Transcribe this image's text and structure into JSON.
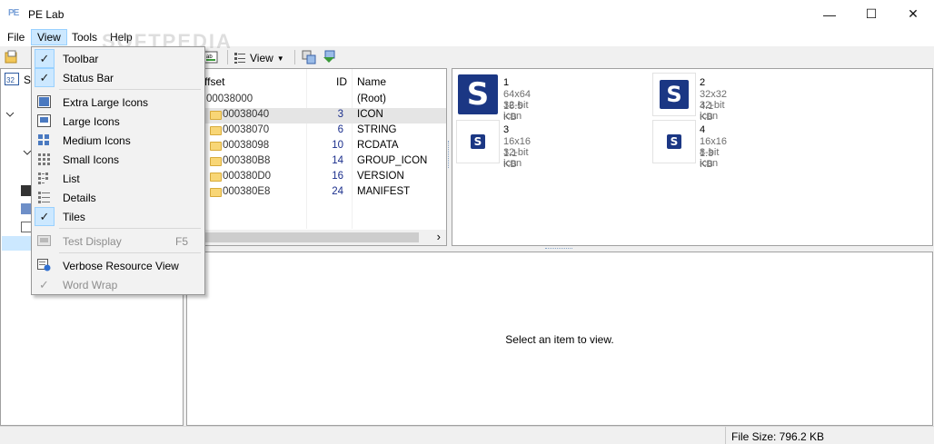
{
  "window": {
    "title": "PE Lab",
    "app_icon_text": "PE",
    "minimize_glyph": "—",
    "maximize_glyph": "☐",
    "close_glyph": "✕"
  },
  "menubar": {
    "file": "File",
    "view": "View",
    "tools": "Tools",
    "help": "Help"
  },
  "toolbar": {
    "view_label": "View",
    "view_arrow": "▼"
  },
  "tree": {
    "top_label": "S"
  },
  "table": {
    "headers": {
      "offset": "ffset",
      "id": "ID",
      "name": "Name"
    },
    "rows": [
      {
        "offset": "00038000",
        "id": "",
        "name": "(Root)"
      },
      {
        "offset": "00038040",
        "id": "3",
        "name": "ICON"
      },
      {
        "offset": "00038070",
        "id": "6",
        "name": "STRING"
      },
      {
        "offset": "00038098",
        "id": "10",
        "name": "RCDATA"
      },
      {
        "offset": "000380B8",
        "id": "14",
        "name": "GROUP_ICON"
      },
      {
        "offset": "000380D0",
        "id": "16",
        "name": "VERSION"
      },
      {
        "offset": "000380E8",
        "id": "24",
        "name": "MANIFEST"
      }
    ],
    "selected_row": 1,
    "scroll_right_glyph": "›"
  },
  "tiles": [
    {
      "title": "1",
      "line1": "64x64 32-bit icon",
      "line2": "16.5 KB"
    },
    {
      "title": "2",
      "line1": "32x32 32-bit icon",
      "line2": "4.1 KB"
    },
    {
      "title": "3",
      "line1": "16x16 32-bit icon",
      "line2": "1.1 KB"
    },
    {
      "title": "4",
      "line1": "16x16 8-bit icon",
      "line2": "1.3 KB"
    }
  ],
  "tile_logo_letter": "S",
  "viewer": {
    "empty_message": "Select an item to view."
  },
  "status": {
    "file_size": "File Size: 796.2 KB"
  },
  "view_menu": {
    "items": [
      {
        "label": "Toolbar",
        "checked": true
      },
      {
        "label": "Status Bar",
        "checked": true
      },
      {
        "label": "Extra Large Icons"
      },
      {
        "label": "Large Icons"
      },
      {
        "label": "Medium Icons"
      },
      {
        "label": "Small Icons"
      },
      {
        "label": "List"
      },
      {
        "label": "Details"
      },
      {
        "label": "Tiles",
        "checked": true
      },
      {
        "label": "Test Display",
        "shortcut": "F5",
        "disabled": true
      },
      {
        "label": "Verbose Resource View"
      },
      {
        "label": "Word Wrap",
        "checked": true,
        "disabled": true
      }
    ],
    "check_glyph": "✓"
  },
  "watermark": "SOFTPEDIA"
}
